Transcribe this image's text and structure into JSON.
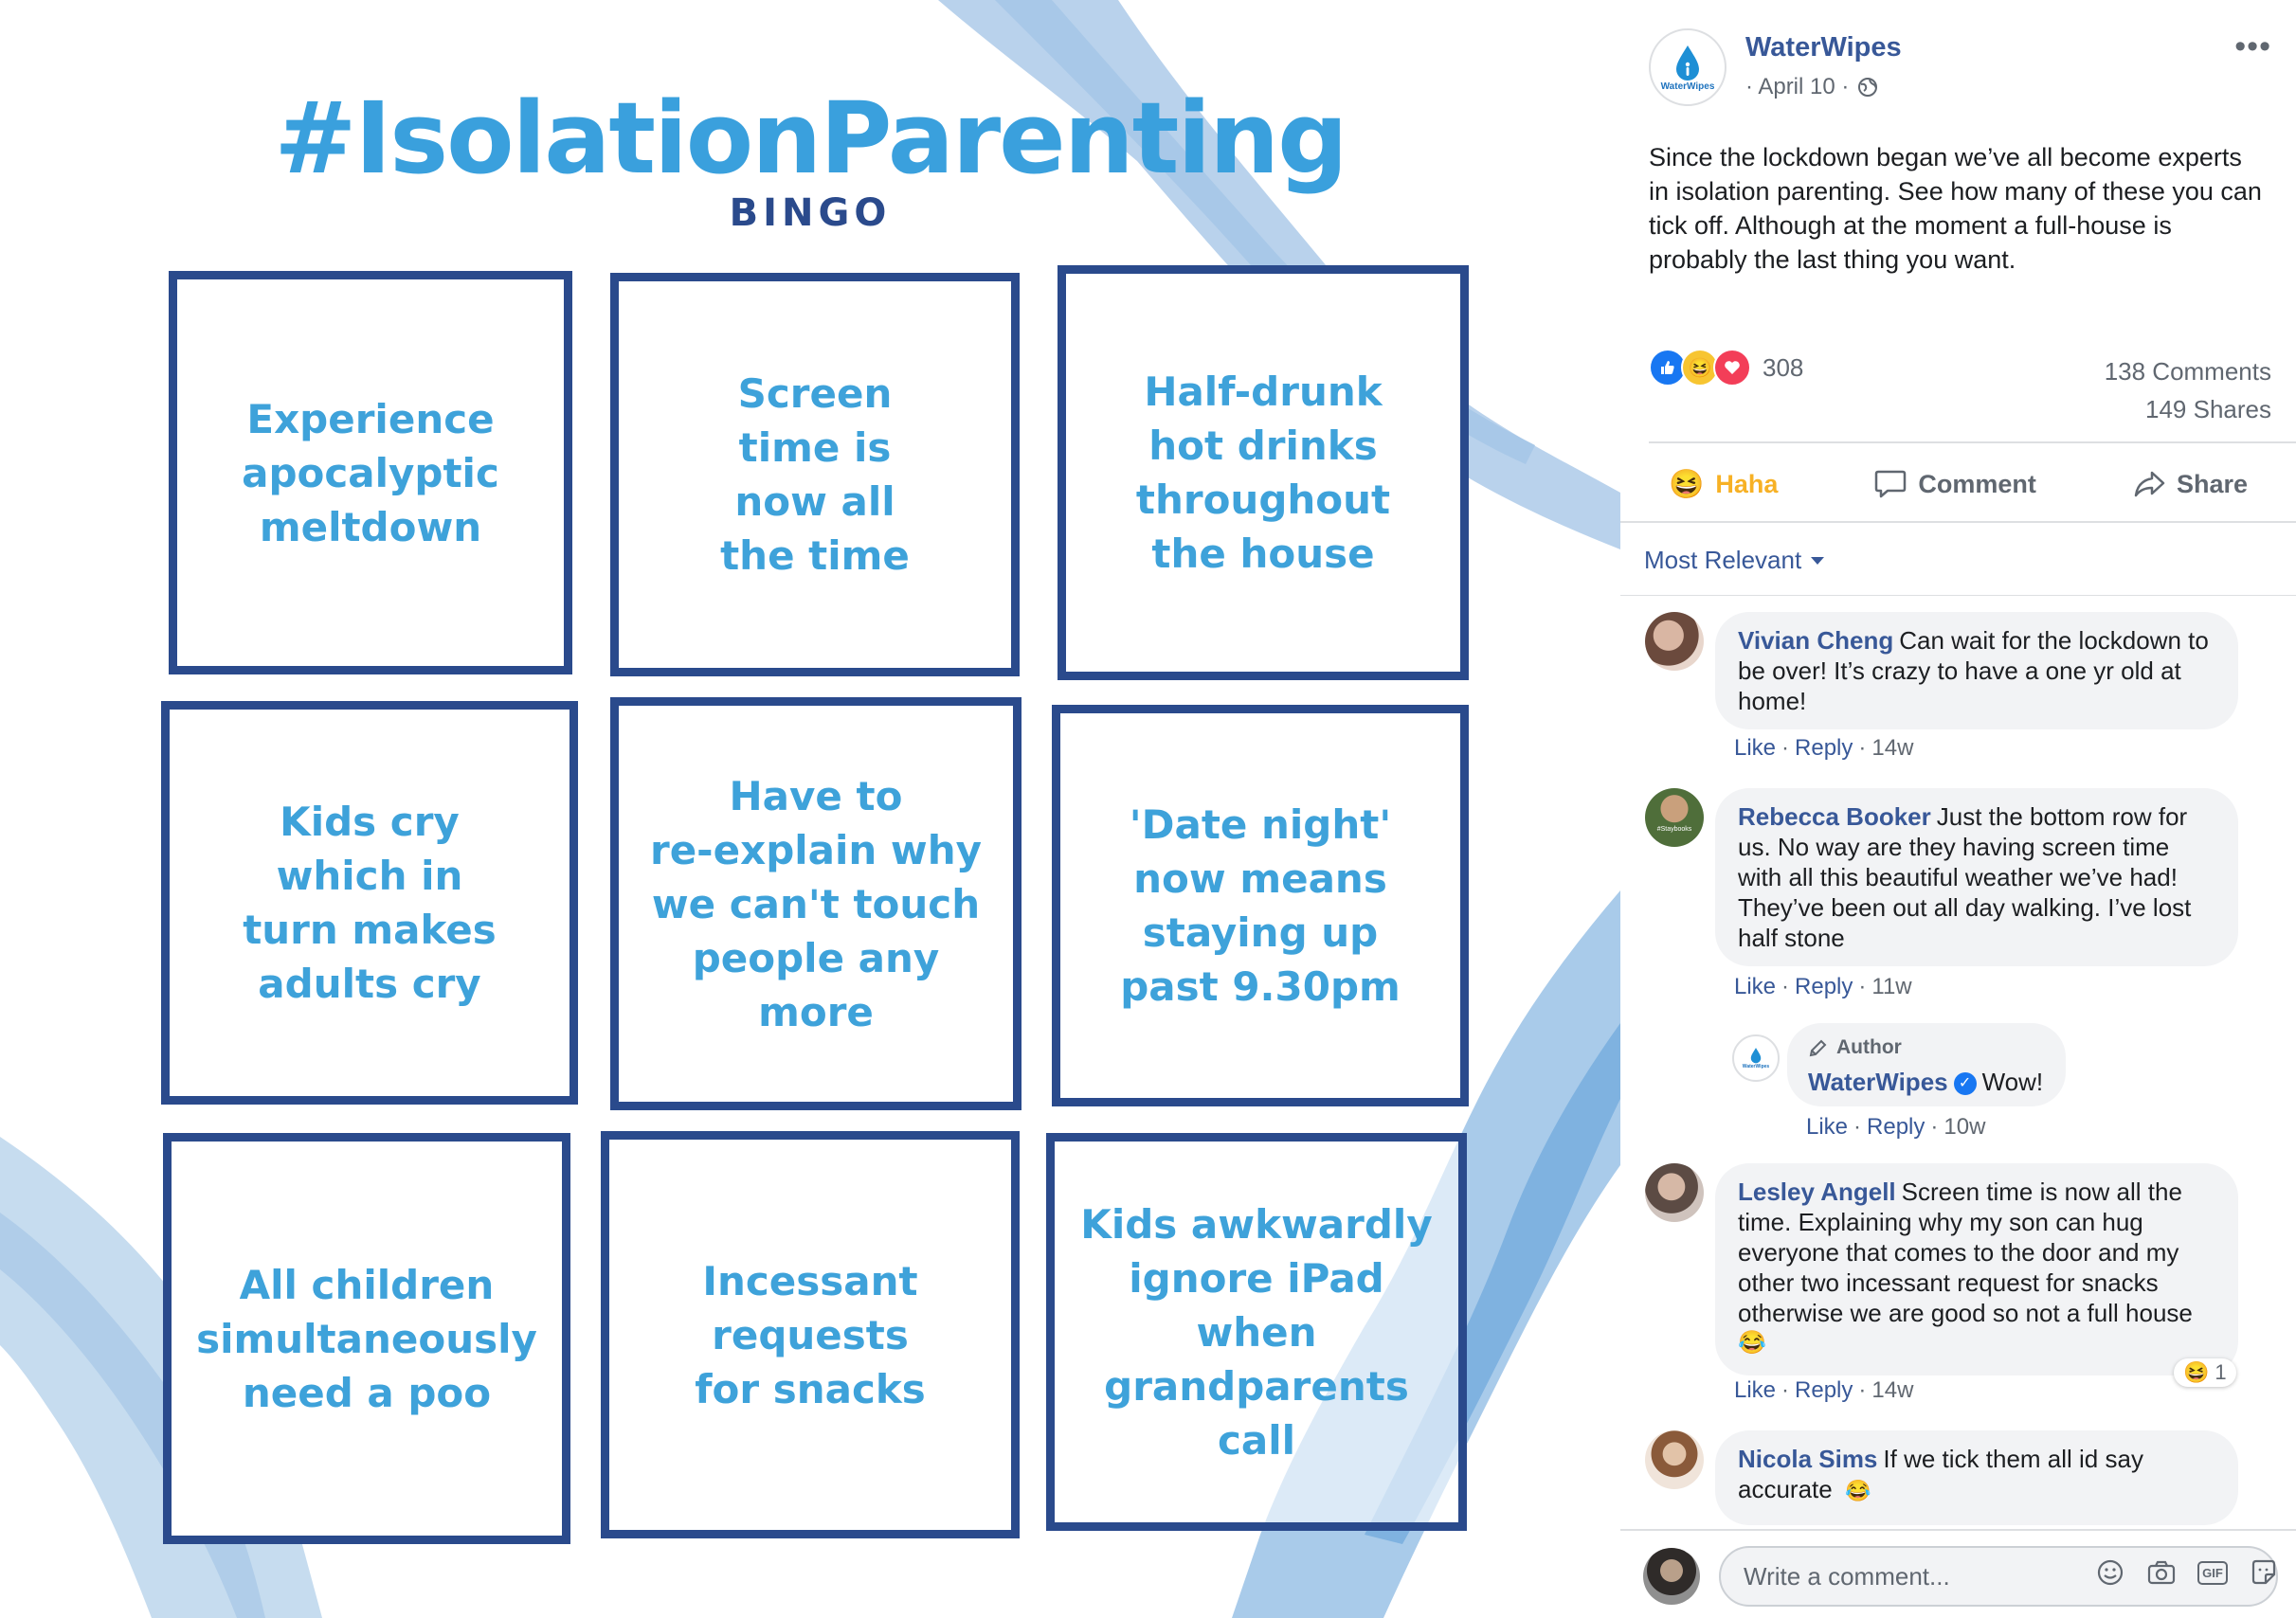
{
  "colors": {
    "title_blue": "#3aa0dd",
    "navy": "#2a4a8c",
    "tile_text": "#3ea2da",
    "brush_light": "#c5d9ee",
    "brush_mid": "#9cc2e6",
    "fb_link": "#385898",
    "fb_gray": "#606770"
  },
  "bingo": {
    "title": "#IsolationParenting",
    "subtitle": "BINGO",
    "tiles": [
      "Experience\napocalyptic\nmeltdown",
      "Screen\ntime is\nnow all\nthe time",
      "Half-drunk\nhot drinks\nthroughout\nthe house",
      "Kids cry\nwhich in\nturn makes\nadults cry",
      "Have to\nre-explain why\nwe can't touch\npeople any more",
      "'Date night'\nnow means\nstaying up\npast 9.30pm",
      "All children\nsimultaneously\nneed a poo",
      "Incessant\nrequests\nfor snacks",
      "Kids awkwardly\nignore iPad when\ngrandparents call"
    ]
  },
  "post": {
    "page_name": "WaterWipes",
    "logo_text": "WaterWipes",
    "date": "· April 10 ·",
    "privacy_icon": "globe-icon",
    "text": "Since the lockdown began we’ve all become experts in isolation parenting. See how many of these you can tick off. Although at the moment a full-house is probably the last thing you want.",
    "reaction_count": "308",
    "comments_count": "138 Comments",
    "shares_count": "149 Shares",
    "actions": {
      "haha": "Haha",
      "comment": "Comment",
      "share": "Share"
    },
    "sort_label": "Most Relevant"
  },
  "comments": [
    {
      "name": "Vivian Cheng",
      "text": "Can wait for the lockdown to be over! It’s crazy to have a one yr old at home!",
      "like": "Like",
      "reply": "Reply",
      "time": "14w"
    },
    {
      "name": "Rebecca Booker",
      "text": "Just the bottom row for us. No way are they having screen time with all this beautiful weather we’ve had! They’ve been out all day walking. I’ve lost half stone",
      "like": "Like",
      "reply": "Reply",
      "time": "11w",
      "avatar_text": "#Staybooks"
    },
    {
      "badge": "Author",
      "name": "WaterWipes",
      "text": "Wow!",
      "like": "Like",
      "reply": "Reply",
      "time": "10w",
      "logo_text": "WaterWipes"
    },
    {
      "name": "Lesley Angell",
      "text": "Screen time is now all the time. Explaining why my son can hug everyone that comes to the door and my other two incessant request for snacks otherwise we are good so not a full house",
      "emoji": "😂",
      "like": "Like",
      "reply": "Reply",
      "time": "14w",
      "reaction_count": "1"
    },
    {
      "name": "Nicola Sims",
      "text": "If we tick them all id say accurate",
      "emoji": "😂"
    }
  ],
  "composer": {
    "placeholder": "Write a comment...",
    "gif_label": "GIF",
    "tools": [
      "emoji-icon",
      "camera-icon",
      "gif-icon",
      "sticker-icon"
    ]
  }
}
